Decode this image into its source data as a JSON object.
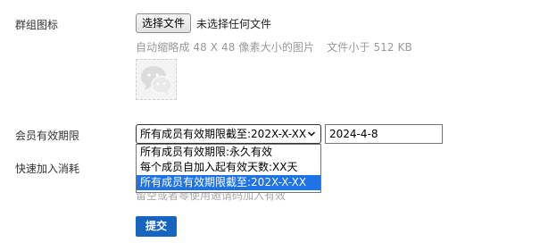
{
  "group_icon": {
    "label": "群组图标",
    "choose_button": "选择文件",
    "file_status": "未选择任何文件",
    "hint_size": "自动缩略成 48 X 48 像素大小的图片",
    "hint_limit": "文件小于 512 KB",
    "preview_icon": "wechat-icon"
  },
  "validity": {
    "label": "会员有效期限",
    "selected": "所有成员有效期限截至:202X-X-XX",
    "date_value": "2024-4-8",
    "options": [
      "所有成员有效期限:永久有效",
      "每个成员自加入起有效天数:XX天",
      "所有成员有效期限截至:202X-X-XX"
    ],
    "selected_index": 2
  },
  "quick_join": {
    "label": "快速加入消耗",
    "hint_partial": "留空或者零使用邀请码加入有效"
  },
  "submit_label": "提交",
  "colors": {
    "accent": "#1565c0",
    "highlight": "#1e73e8"
  }
}
